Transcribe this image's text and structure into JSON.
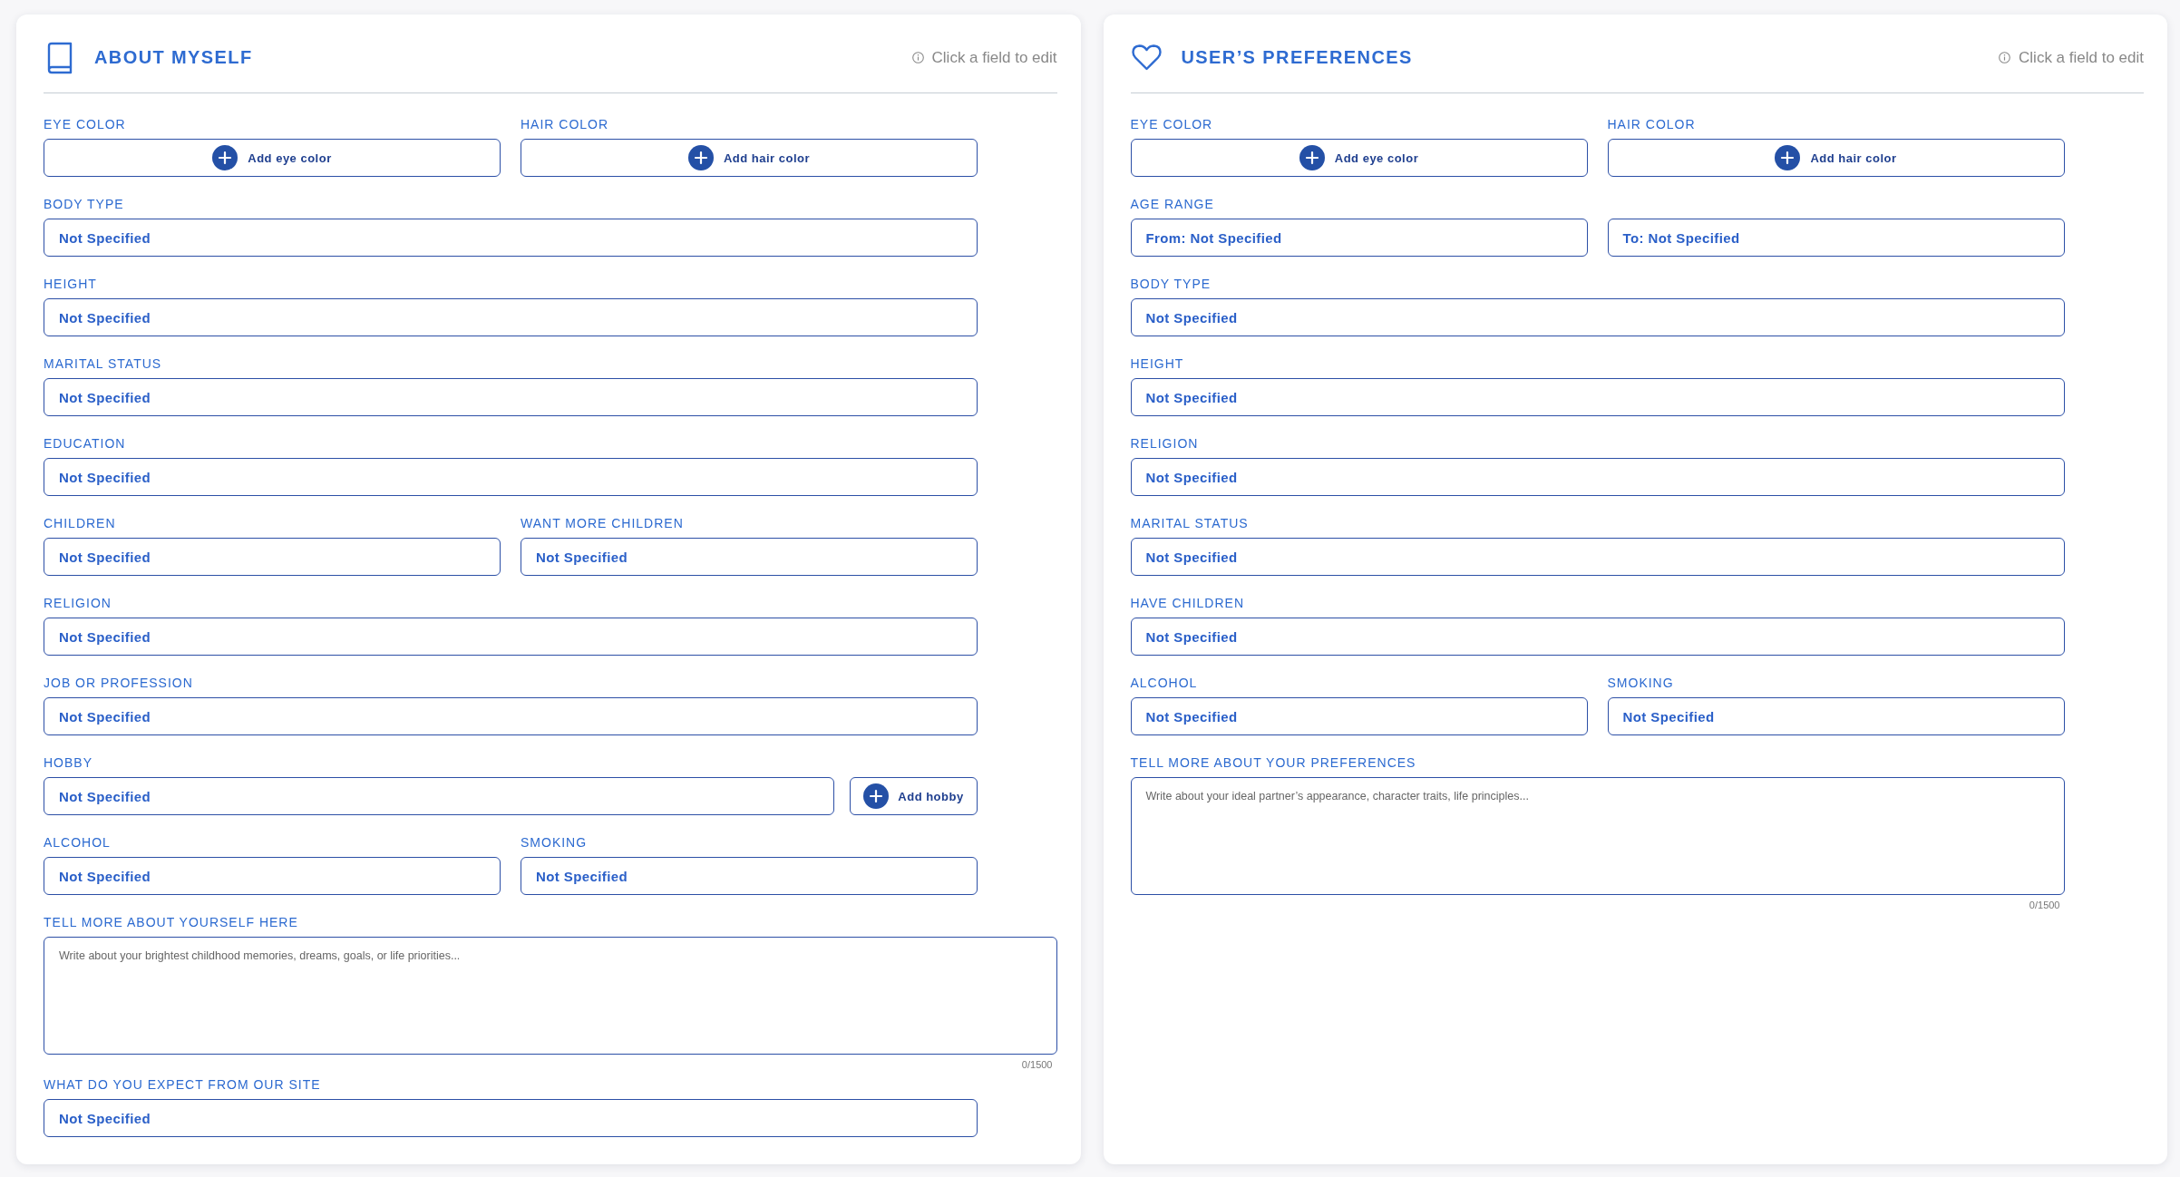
{
  "panels": [
    {
      "kind": "profile",
      "title": "ABOUT MYSELF",
      "hint": "Click a field to edit",
      "rows": [
        {
          "fields": [
            {
              "kind": "add",
              "label": "EYE COLOR",
              "action": "Add eye color"
            },
            {
              "kind": "add",
              "label": "HAIR COLOR",
              "action": "Add hair color"
            }
          ]
        },
        {
          "fields": [
            {
              "kind": "select",
              "label": "BODY TYPE",
              "value": "Not Specified"
            }
          ]
        },
        {
          "fields": [
            {
              "kind": "select",
              "label": "HEIGHT",
              "value": "Not Specified"
            }
          ]
        },
        {
          "fields": [
            {
              "kind": "select",
              "label": "MARITAL STATUS",
              "value": "Not Specified"
            }
          ]
        },
        {
          "fields": [
            {
              "kind": "select",
              "label": "EDUCATION",
              "value": "Not Specified"
            }
          ]
        },
        {
          "fields": [
            {
              "kind": "select",
              "label": "CHILDREN",
              "value": "Not Specified"
            },
            {
              "kind": "select",
              "label": "WANT MORE CHILDREN",
              "value": "Not Specified"
            }
          ]
        },
        {
          "fields": [
            {
              "kind": "select",
              "label": "RELIGION",
              "value": "Not Specified"
            }
          ]
        },
        {
          "fields": [
            {
              "kind": "select",
              "label": "JOB OR PROFESSION",
              "value": "Not Specified"
            }
          ]
        },
        {
          "fields": [
            {
              "kind": "combo",
              "label": "HOBBY",
              "value": "Not Specified",
              "action": "Add hobby"
            }
          ]
        },
        {
          "fields": [
            {
              "kind": "select",
              "label": "ALCOHOL",
              "value": "Not Specified"
            },
            {
              "kind": "select",
              "label": "SMOKING",
              "value": "Not Specified"
            }
          ]
        },
        {
          "fields": [
            {
              "kind": "text",
              "label": "TELL MORE ABOUT YOURSELF HERE",
              "placeholder": "Write about your brightest childhood memories, dreams, goals, or life priorities...",
              "counter": "0/1500"
            }
          ]
        },
        {
          "fields": [
            {
              "kind": "select",
              "label": "WHAT DO YOU EXPECT FROM OUR SITE",
              "value": "Not Specified"
            }
          ]
        }
      ]
    },
    {
      "kind": "preferences",
      "title": "USER’S PREFERENCES",
      "hint": "Click a field to edit",
      "rows": [
        {
          "fields": [
            {
              "kind": "add",
              "label": "EYE COLOR",
              "action": "Add eye color"
            },
            {
              "kind": "add",
              "label": "HAIR COLOR",
              "action": "Add hair color"
            }
          ]
        },
        {
          "fields": [
            {
              "kind": "range",
              "label": "AGE RANGE",
              "values": [
                "From: Not Specified",
                "To: Not Specified"
              ]
            }
          ]
        },
        {
          "fields": [
            {
              "kind": "select",
              "label": "BODY TYPE",
              "value": "Not Specified"
            }
          ]
        },
        {
          "fields": [
            {
              "kind": "select",
              "label": "HEIGHT",
              "value": "Not Specified"
            }
          ]
        },
        {
          "fields": [
            {
              "kind": "select",
              "label": "RELIGION",
              "value": "Not Specified"
            }
          ]
        },
        {
          "fields": [
            {
              "kind": "select",
              "label": "MARITAL STATUS",
              "value": "Not Specified"
            }
          ]
        },
        {
          "fields": [
            {
              "kind": "select",
              "label": "HAVE CHILDREN",
              "value": "Not Specified"
            }
          ]
        },
        {
          "fields": [
            {
              "kind": "select",
              "label": "ALCOHOL",
              "value": "Not Specified"
            },
            {
              "kind": "select",
              "label": "SMOKING",
              "value": "Not Specified"
            }
          ]
        },
        {
          "fields": [
            {
              "kind": "text",
              "label": "TELL MORE ABOUT YOUR PREFERENCES",
              "placeholder": "Write about your ideal partner’s appearance, character traits, life principles...",
              "counter": "0/1500"
            }
          ]
        }
      ]
    }
  ]
}
